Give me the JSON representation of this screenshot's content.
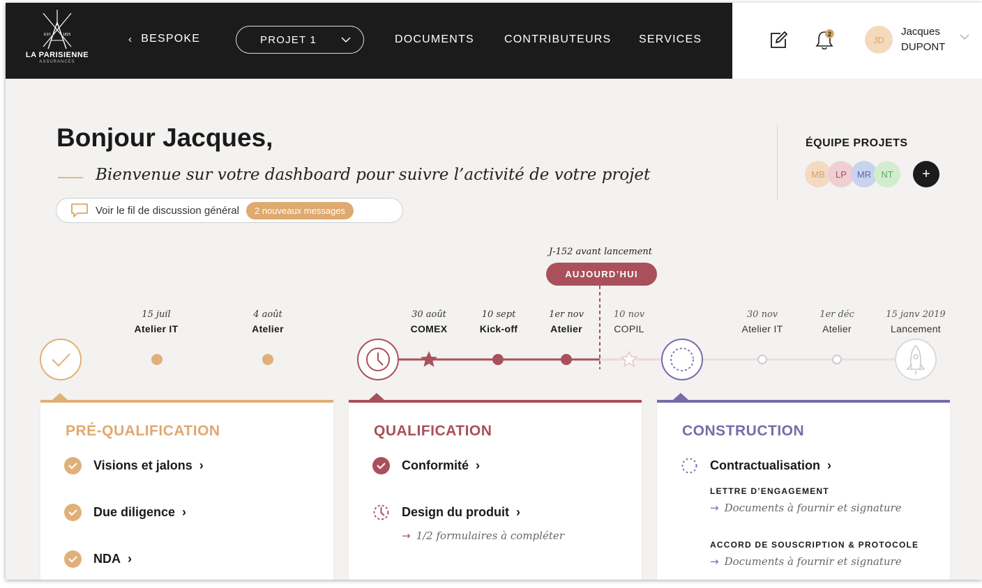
{
  "brand": {
    "name": "LA PARISIENNE",
    "sub": "ASSURANCES",
    "est": "EST.",
    "year": "1829"
  },
  "nav": {
    "back_label": "BESPOKE",
    "project_label": "PROJET 1",
    "links": [
      "DOCUMENTS",
      "CONTRIBUTEURS",
      "SERVICES"
    ]
  },
  "header": {
    "notification_count": "2",
    "user_initials": "JD",
    "user_first": "Jacques",
    "user_last": "DUPONT"
  },
  "greeting": {
    "title": "Bonjour Jacques,",
    "subtitle": "Bienvenue sur votre dashboard pour suivre l’activité de votre projet",
    "discussion_label": "Voir le fil de discussion général",
    "discussion_badge": "2 nouveaux messages"
  },
  "team": {
    "title": "ÉQUIPE PROJETS",
    "members": [
      {
        "initials": "MB",
        "bg": "#f5d9c1",
        "fg": "#d4a26a"
      },
      {
        "initials": "LP",
        "bg": "#f0cfd4",
        "fg": "#a9505b"
      },
      {
        "initials": "MR",
        "bg": "#c9d2ee",
        "fg": "#5b6aa8"
      },
      {
        "initials": "NT",
        "bg": "#d3ecd0",
        "fg": "#5caa5a"
      }
    ],
    "add_label": "+"
  },
  "timeline": {
    "today_note": "J-152 avant lancement",
    "today_label": "AUJOURD’HUI",
    "milestones": [
      {
        "date": "15 juil",
        "name": "Atelier IT",
        "state": "past"
      },
      {
        "date": "4 août",
        "name": "Atelier",
        "state": "past"
      },
      {
        "date": "30 août",
        "name": "COMEX",
        "state": "current"
      },
      {
        "date": "10 sept",
        "name": "Kick-off",
        "state": "current"
      },
      {
        "date": "1er nov",
        "name": "Atelier",
        "state": "current"
      },
      {
        "date": "10 nov",
        "name": "COPIL",
        "state": "future"
      },
      {
        "date": "30 nov",
        "name": "Atelier IT",
        "state": "future"
      },
      {
        "date": "1er déc",
        "name": "Atelier",
        "state": "future"
      },
      {
        "date": "15 janv 2019",
        "name": "Lancement",
        "state": "future"
      }
    ]
  },
  "colors": {
    "pre": "#e0b079",
    "qual": "#a9505b",
    "cons": "#7a6aa8",
    "future": "#d9d6d8"
  },
  "phases": [
    {
      "title": "PRÉ-QUALIFICATION",
      "tasks": [
        "Visions et jalons",
        "Due diligence",
        "NDA"
      ]
    },
    {
      "title": "QUALIFICATION",
      "tasks": [
        "Conformité",
        "Design du produit"
      ],
      "note": "1/2 formulaires à compléter"
    },
    {
      "title": "CONSTRUCTION",
      "tasks": [
        "Contractualisation"
      ],
      "subsections": [
        {
          "head": "LETTRE D’ENGAGEMENT",
          "note": "Documents à fournir et signature"
        },
        {
          "head": "ACCORD DE SOUSCRIPTION & PROTOCOLE",
          "note": "Documents à fournir et signature"
        }
      ]
    }
  ],
  "icons": [
    "logo-mark",
    "chevron-left-icon",
    "chevron-down-icon",
    "edit-icon",
    "bell-icon",
    "chat-bubble-icon",
    "check-icon",
    "clock-icon",
    "star-icon",
    "dashed-circle-icon",
    "rocket-icon",
    "arrow-right-icon"
  ]
}
